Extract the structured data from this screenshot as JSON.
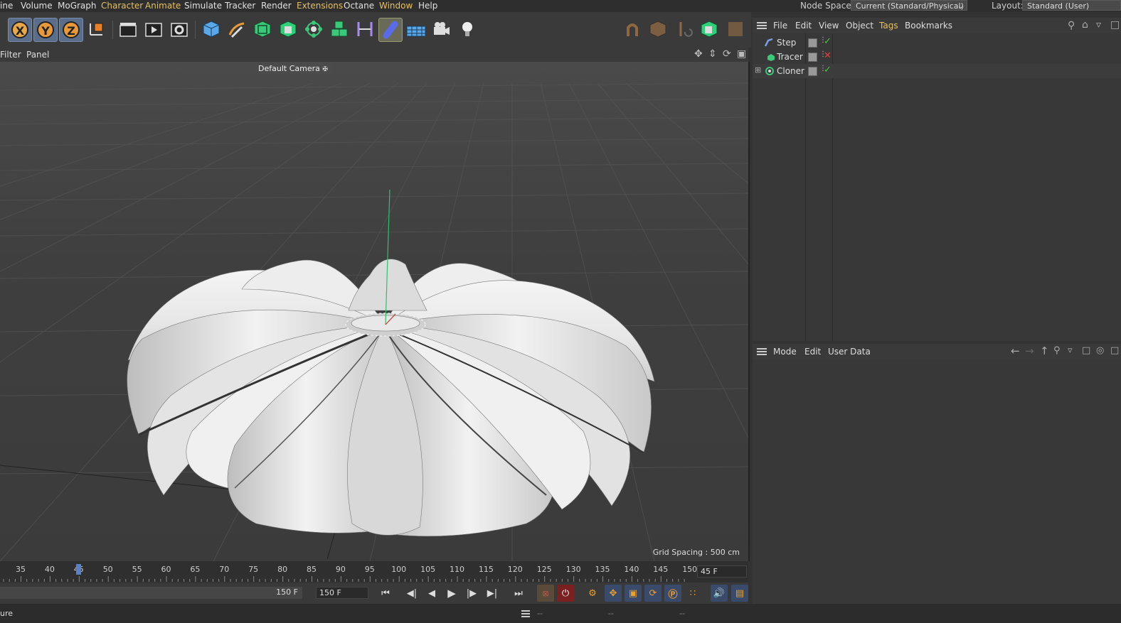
{
  "menubar": {
    "items": [
      "ine",
      "Volume",
      "MoGraph",
      "Character",
      "Animate",
      "Simulate",
      "Tracker",
      "Render",
      "Extensions",
      "Octane",
      "Window",
      "Help"
    ],
    "node_space_label": "Node Space:",
    "node_space_value": "Current (Standard/Physical)",
    "layout_label": "Layout:",
    "layout_value": "Standard (User)"
  },
  "toolbar": {
    "axis_x": "X",
    "axis_y": "Y",
    "axis_z": "Z"
  },
  "viewport": {
    "menu": [
      "Filter",
      "Panel"
    ],
    "camera": "Default Camera",
    "grid_spacing": "Grid Spacing : 500 cm"
  },
  "timeline": {
    "ticks": [
      "35",
      "40",
      "45",
      "50",
      "55",
      "60",
      "65",
      "70",
      "75",
      "80",
      "85",
      "90",
      "95",
      "100",
      "105",
      "110",
      "115",
      "120",
      "125",
      "130",
      "135",
      "140",
      "145",
      "150"
    ],
    "current_frame": "45 F",
    "end_frame_left": "150 F",
    "end_frame_right": "150 F"
  },
  "object_manager": {
    "menu": [
      "File",
      "Edit",
      "View",
      "Object",
      "Tags",
      "Bookmarks"
    ],
    "objects": [
      {
        "name": "Step",
        "enabled": true
      },
      {
        "name": "Tracer",
        "enabled": false
      },
      {
        "name": "Cloner",
        "enabled": true
      }
    ]
  },
  "attribute_manager": {
    "menu": [
      "Mode",
      "Edit",
      "User Data"
    ]
  },
  "statusbar": {
    "left_text": "ure",
    "fields": [
      "--",
      "--",
      "--"
    ]
  },
  "colors": {
    "accent": "#e8c060",
    "axis_button": "#5a6e8c",
    "check_green": "#4ec04e",
    "cross_red": "#e04040"
  }
}
